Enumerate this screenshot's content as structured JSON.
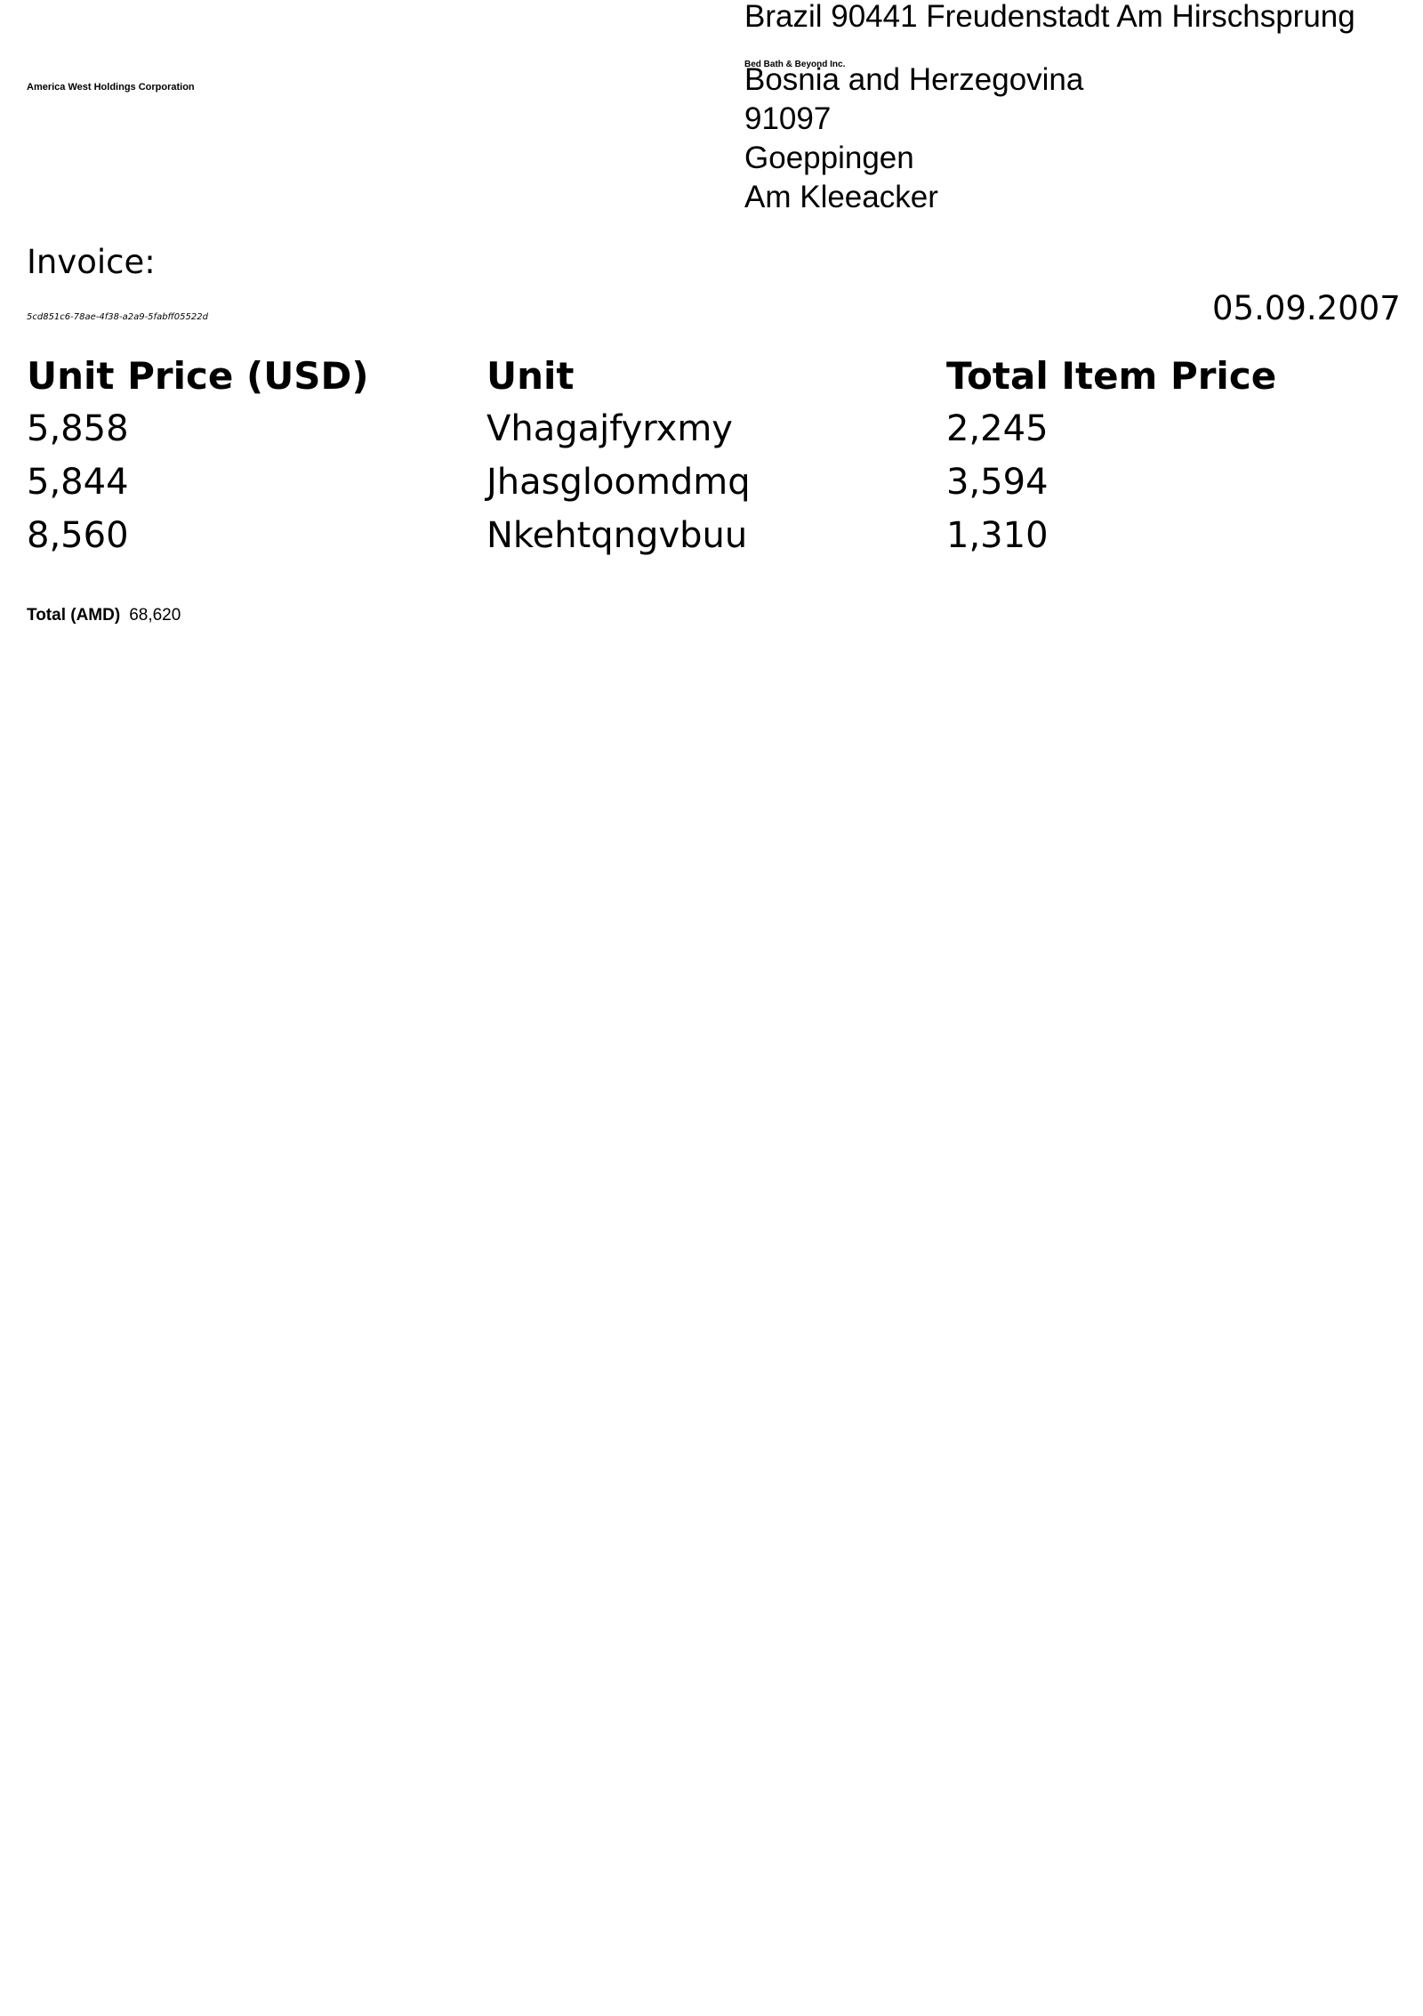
{
  "sender": {
    "company": "America West Holdings Corporation"
  },
  "recipient": {
    "address_line": "Brazil 90441 Freudenstadt Am Hirschsprung",
    "company": "Bed Bath & Beyond Inc.",
    "country": "Bosnia and Herzegovina",
    "postal_code": "91097",
    "city": "Goeppingen",
    "street": "Am Kleeacker"
  },
  "invoice": {
    "label": "Invoice:",
    "id": "5cd851c6-78ae-4f38-a2a9-5fabff05522d",
    "date": "05.09.2007"
  },
  "table": {
    "headers": [
      "Unit Price (USD)",
      "Unit",
      "Total Item Price"
    ],
    "rows": [
      [
        "5,858",
        "Vhagajfyrxmy",
        "2,245"
      ],
      [
        "5,844",
        "Jhasgloomdmq",
        "3,594"
      ],
      [
        "8,560",
        "Nkehtqngvbuu",
        "1,310"
      ]
    ]
  },
  "total": {
    "label": "Total (AMD)",
    "value": "68,620"
  }
}
